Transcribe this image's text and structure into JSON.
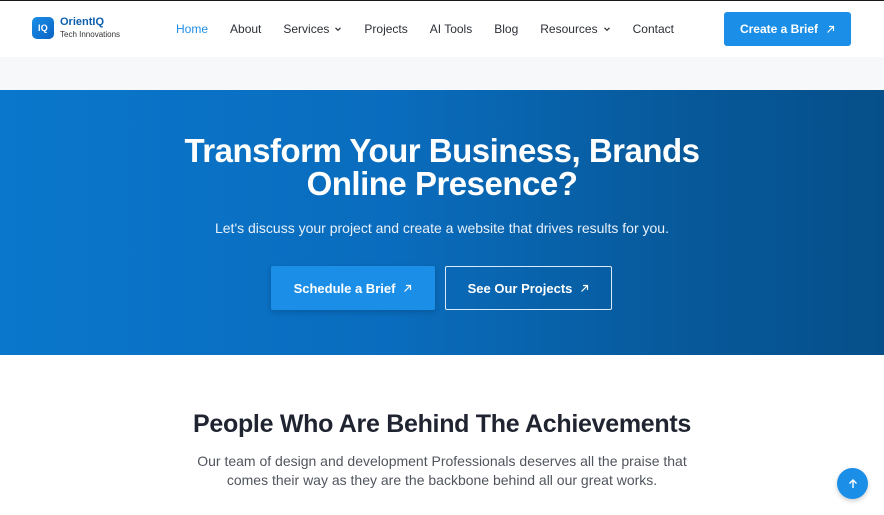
{
  "brand": {
    "mark": "IQ",
    "name": "OrientIQ",
    "tagline": "Tech Innovations"
  },
  "nav": {
    "items": [
      {
        "label": "Home",
        "active": true
      },
      {
        "label": "About"
      },
      {
        "label": "Services",
        "dropdown": true
      },
      {
        "label": "Projects"
      },
      {
        "label": "AI Tools"
      },
      {
        "label": "Blog"
      },
      {
        "label": "Resources",
        "dropdown": true
      },
      {
        "label": "Contact"
      }
    ],
    "cta_label": "Create a Brief"
  },
  "hero": {
    "title_line1": "Transform Your Business, Brands",
    "title_line2": "Online Presence?",
    "subtitle": "Let's discuss your project and create a website that drives results for you.",
    "primary_button": "Schedule a Brief",
    "secondary_button": "See Our Projects"
  },
  "team": {
    "title": "People Who Are Behind The Achievements",
    "text_line1": "Our team of design and development Professionals deserves all the praise that",
    "text_line2": "comes their way as they are the backbone behind all our great works."
  },
  "icons": {
    "arrow": "arrow-up-right-icon",
    "chevron": "chevron-down-icon",
    "scroll_top": "arrow-up-icon"
  },
  "colors": {
    "accent": "#1b8fe8",
    "hero_start": "#0a77cc",
    "hero_end": "#064f8a",
    "nav_active": "#1f8fe6"
  }
}
